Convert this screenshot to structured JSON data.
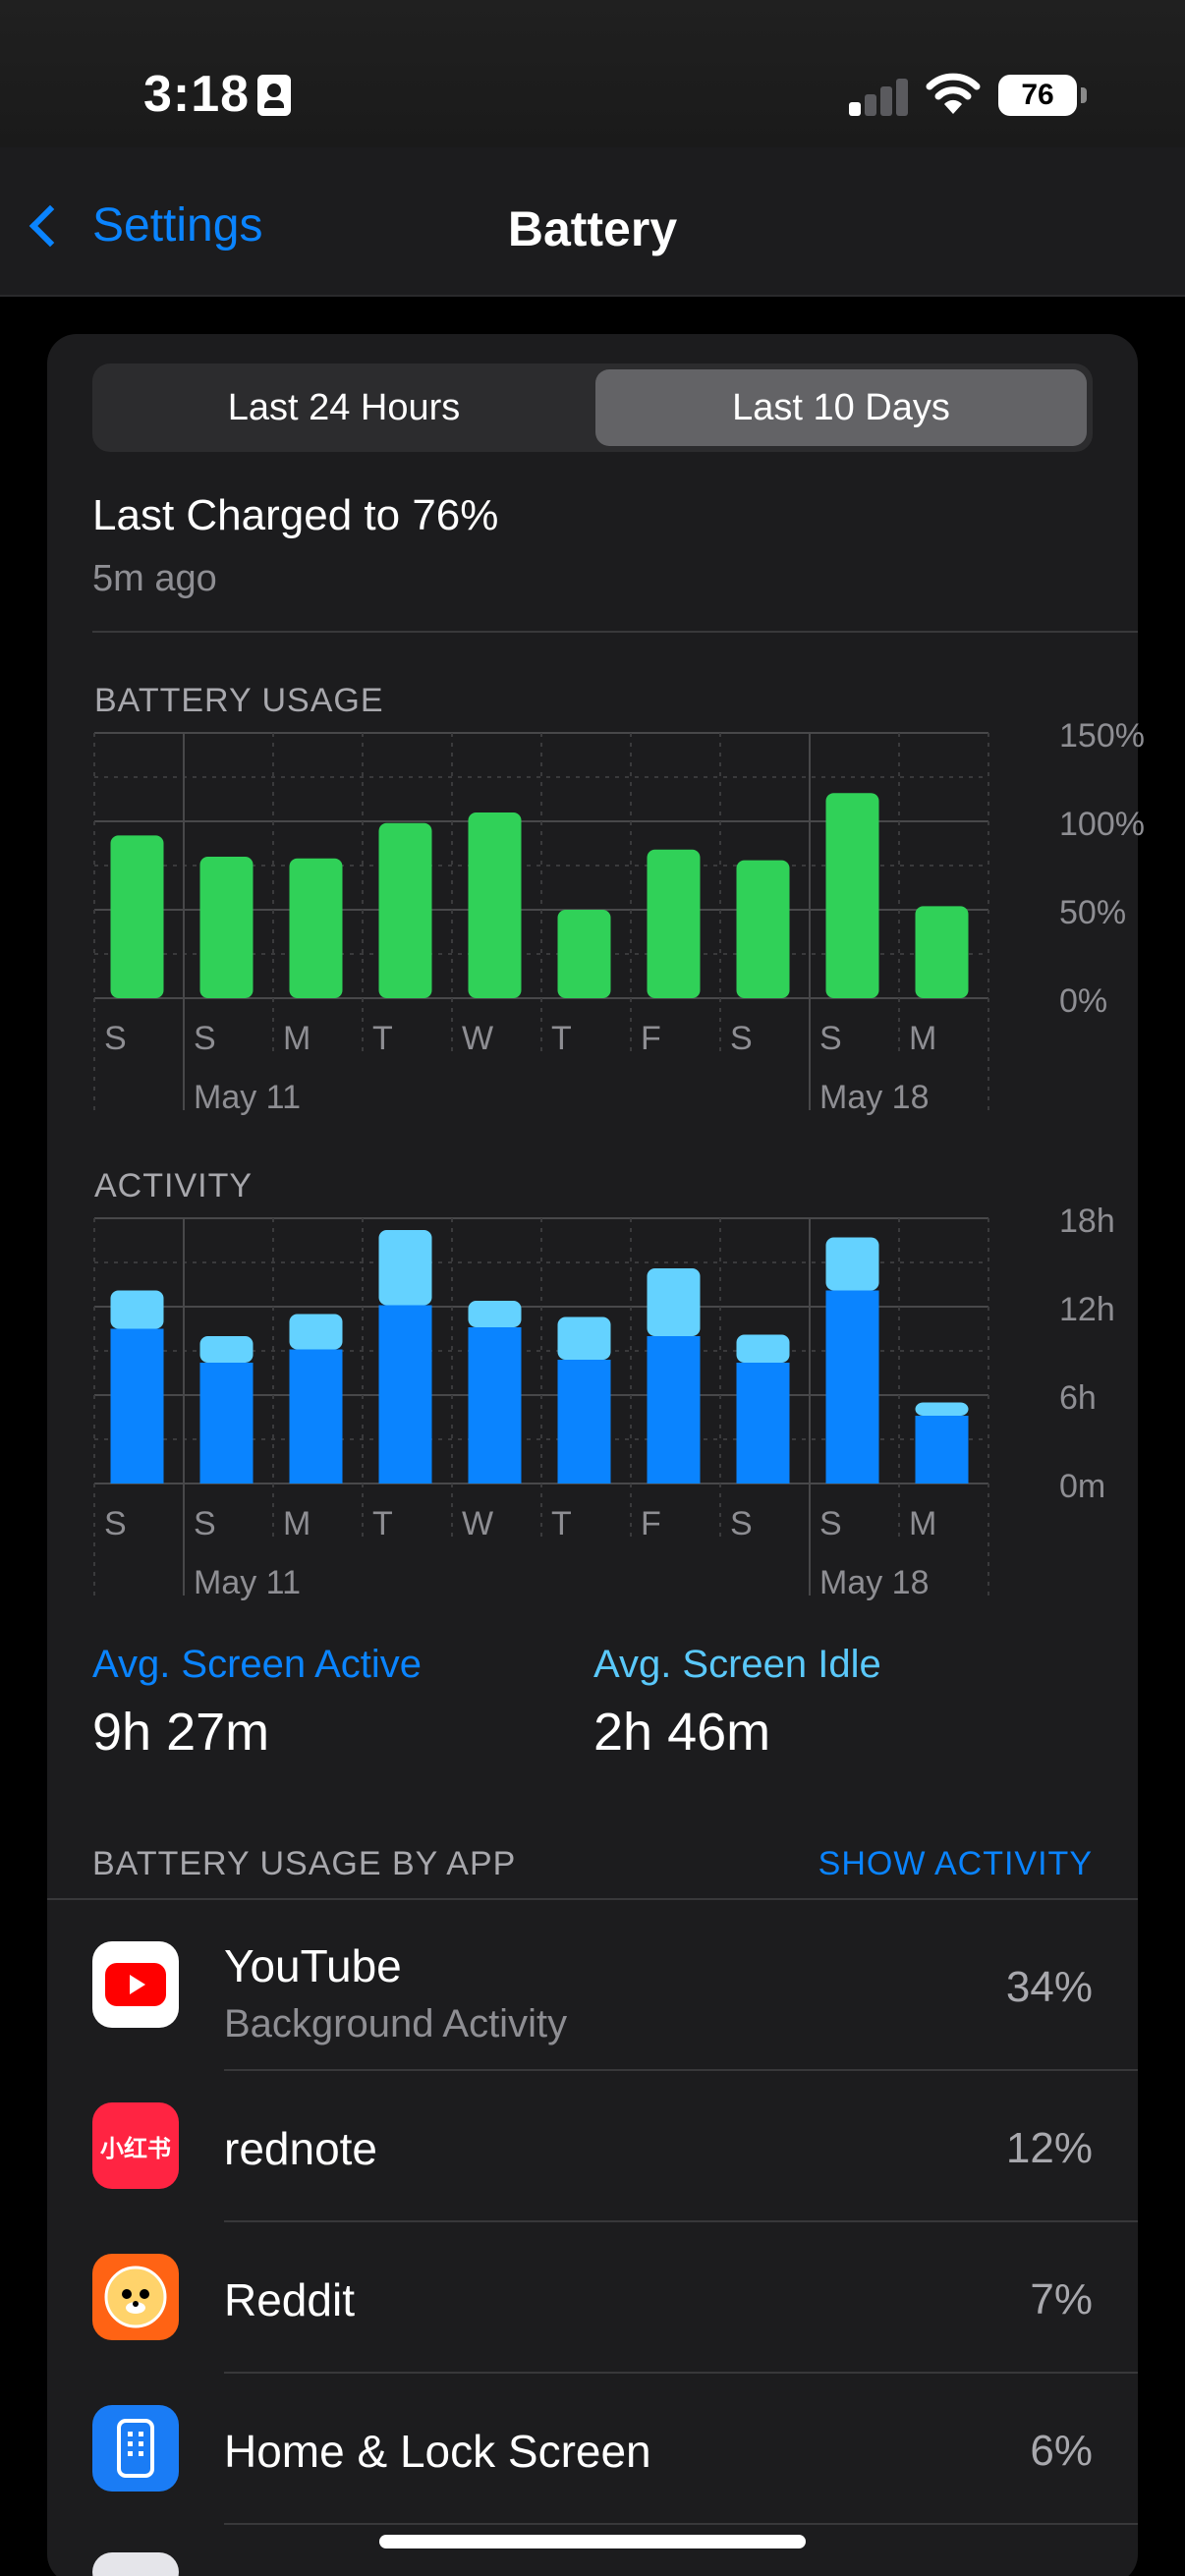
{
  "status": {
    "time": "3:18",
    "battery": "76"
  },
  "nav": {
    "back_label": "Settings",
    "title": "Battery"
  },
  "segments": [
    "Last 24 Hours",
    "Last 10 Days"
  ],
  "selected_segment": 1,
  "last_charged": {
    "title": "Last Charged to 76%",
    "ago": "5m ago"
  },
  "battery_usage_label": "BATTERY USAGE",
  "activity_label": "ACTIVITY",
  "stats": {
    "active_label": "Avg. Screen Active",
    "active_value": "9h 27m",
    "idle_label": "Avg. Screen Idle",
    "idle_value": "2h 46m"
  },
  "bua": {
    "header": "BATTERY USAGE BY APP",
    "action": "SHOW ACTIVITY"
  },
  "apps": [
    {
      "name": "YouTube",
      "sub": "Background Activity",
      "pct": "34%",
      "icon": "youtube-icon"
    },
    {
      "name": "rednote",
      "sub": "",
      "pct": "12%",
      "icon": "rednote-icon",
      "icon_text": "小红书"
    },
    {
      "name": "Reddit",
      "sub": "",
      "pct": "7%",
      "icon": "reddit-icon"
    },
    {
      "name": "Home & Lock Screen",
      "sub": "",
      "pct": "6%",
      "icon": "home-lock-screen-icon"
    }
  ],
  "colors": {
    "usage_bar": "#30d158",
    "active_bar": "#0a84ff",
    "idle_bar": "#64d2ff",
    "accent": "#0a84ff",
    "idle_accent": "#5ac8fa"
  },
  "chart_data": [
    {
      "type": "bar",
      "title": "BATTERY USAGE",
      "categories": [
        "S",
        "S",
        "M",
        "T",
        "W",
        "T",
        "F",
        "S",
        "S",
        "M"
      ],
      "date_labels": [
        "May 11",
        "May 18"
      ],
      "values": [
        92,
        80,
        79,
        99,
        105,
        50,
        84,
        78,
        116,
        52
      ],
      "ylim": [
        0,
        150
      ],
      "yticks": [
        "150%",
        "100%",
        "50%",
        "0%"
      ],
      "grid": true
    },
    {
      "type": "bar",
      "title": "ACTIVITY",
      "categories": [
        "S",
        "S",
        "M",
        "T",
        "W",
        "T",
        "F",
        "S",
        "S",
        "M"
      ],
      "date_labels": [
        "May 11",
        "May 18"
      ],
      "series": [
        {
          "name": "Avg. Screen Active",
          "values": [
            10.5,
            8.2,
            9.1,
            12.1,
            10.6,
            8.4,
            10.0,
            8.2,
            13.1,
            4.6
          ]
        },
        {
          "name": "Avg. Screen Idle",
          "values": [
            2.6,
            1.8,
            2.4,
            5.1,
            1.8,
            2.9,
            4.6,
            1.9,
            3.6,
            0.9
          ]
        }
      ],
      "stacked": true,
      "ylim": [
        0,
        18
      ],
      "yticks": [
        "18h",
        "12h",
        "6h",
        "0m"
      ],
      "grid": true
    }
  ]
}
